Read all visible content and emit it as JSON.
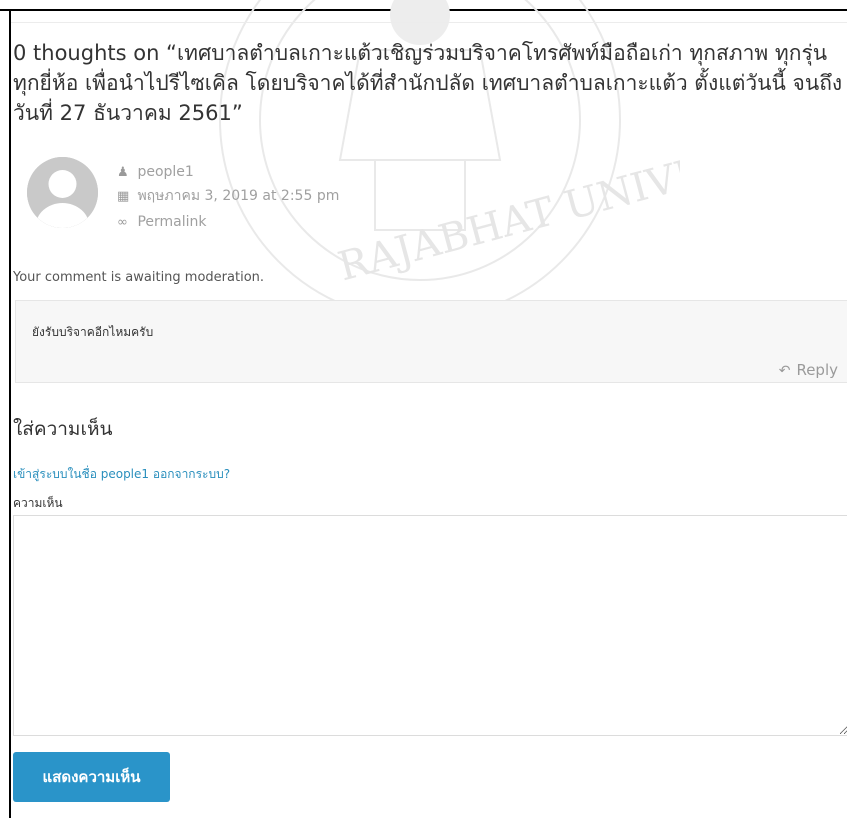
{
  "colors": {
    "accent": "#2a94c9",
    "link": "#2a8fbd",
    "muted": "#a0a0a0",
    "text": "#333333"
  },
  "comments": {
    "title": "0 thoughts on “เทศบาลตำบลเกาะแต้วเชิญร่วมบริจาคโทรศัพท์มือถือเก่า ทุกสภาพ ทุกรุ่น ทุกยี่ห้อ เพื่อนำไปรีไซเคิล โดยบริจาคได้ที่สำนักปลัด เทศบาลตำบลเกาะแต้ว ตั้งแต่วันนี้ จนถึงวันที่ 27 ธันวาคม 2561”",
    "items": [
      {
        "author": "people1",
        "author_icon": "user-icon",
        "date": "พฤษภาคม 3, 2019 at 2:55 pm",
        "date_icon": "calendar-icon",
        "permalink": "Permalink",
        "permalink_icon": "link-icon",
        "moderation_note": "Your comment is awaiting moderation.",
        "text": "ยังรับบริจาคอีกไหมครับ",
        "reply_label": "Reply",
        "reply_icon": "reply-icon"
      }
    ]
  },
  "form": {
    "heading": "ใส่ความเห็น",
    "logged_in_prefix": "เข้าสู่ระบบในชื่อ people1",
    "logout_label": "ออกจากระบบ?",
    "comment_label": "ความเห็น",
    "comment_value": "",
    "submit_label": "แสดงความเห็น"
  }
}
